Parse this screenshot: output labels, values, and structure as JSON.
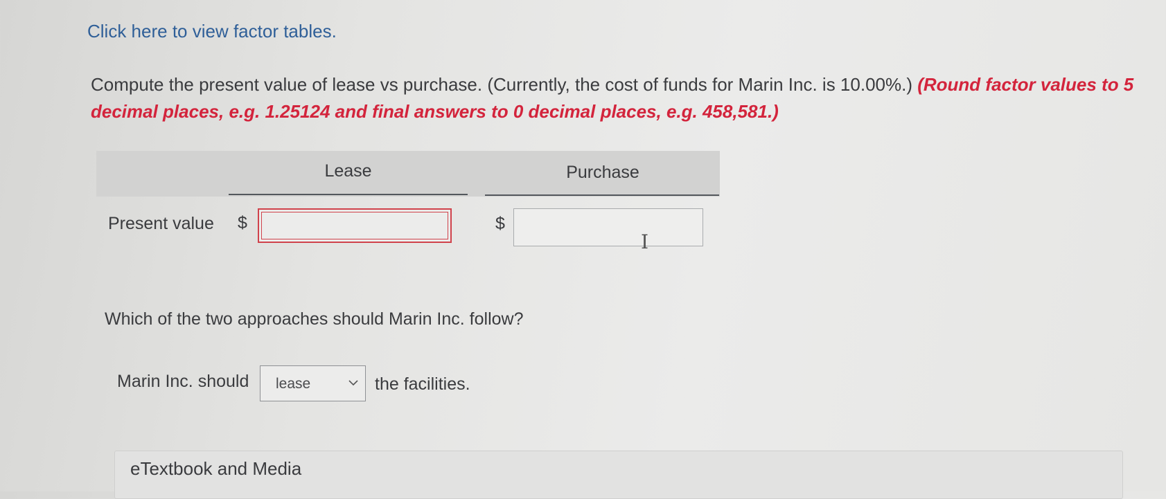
{
  "link_text": "Click here to view factor tables.",
  "question": {
    "text": "Compute the present value of lease vs purchase. (Currently, the cost of funds for Marin Inc. is 10.00%.) ",
    "instruction": "(Round factor values to 5 decimal places, e.g. 1.25124 and final answers to 0 decimal places, e.g. 458,581.)"
  },
  "table": {
    "col_lease": "Lease",
    "col_purchase": "Purchase",
    "row_label": "Present value",
    "currency": "$",
    "lease_value": "",
    "purchase_value": ""
  },
  "followup": {
    "question": "Which of the two approaches should Marin Inc. follow?",
    "prefix": "Marin Inc. should",
    "selected": "lease",
    "suffix": "the facilities."
  },
  "etextbook": "eTextbook and Media",
  "colors": {
    "link": "#2f5f98",
    "instruction": "#d3243c",
    "error_border": "#d0424b"
  },
  "icons": [
    "chevron-down-icon",
    "text-cursor-icon"
  ]
}
